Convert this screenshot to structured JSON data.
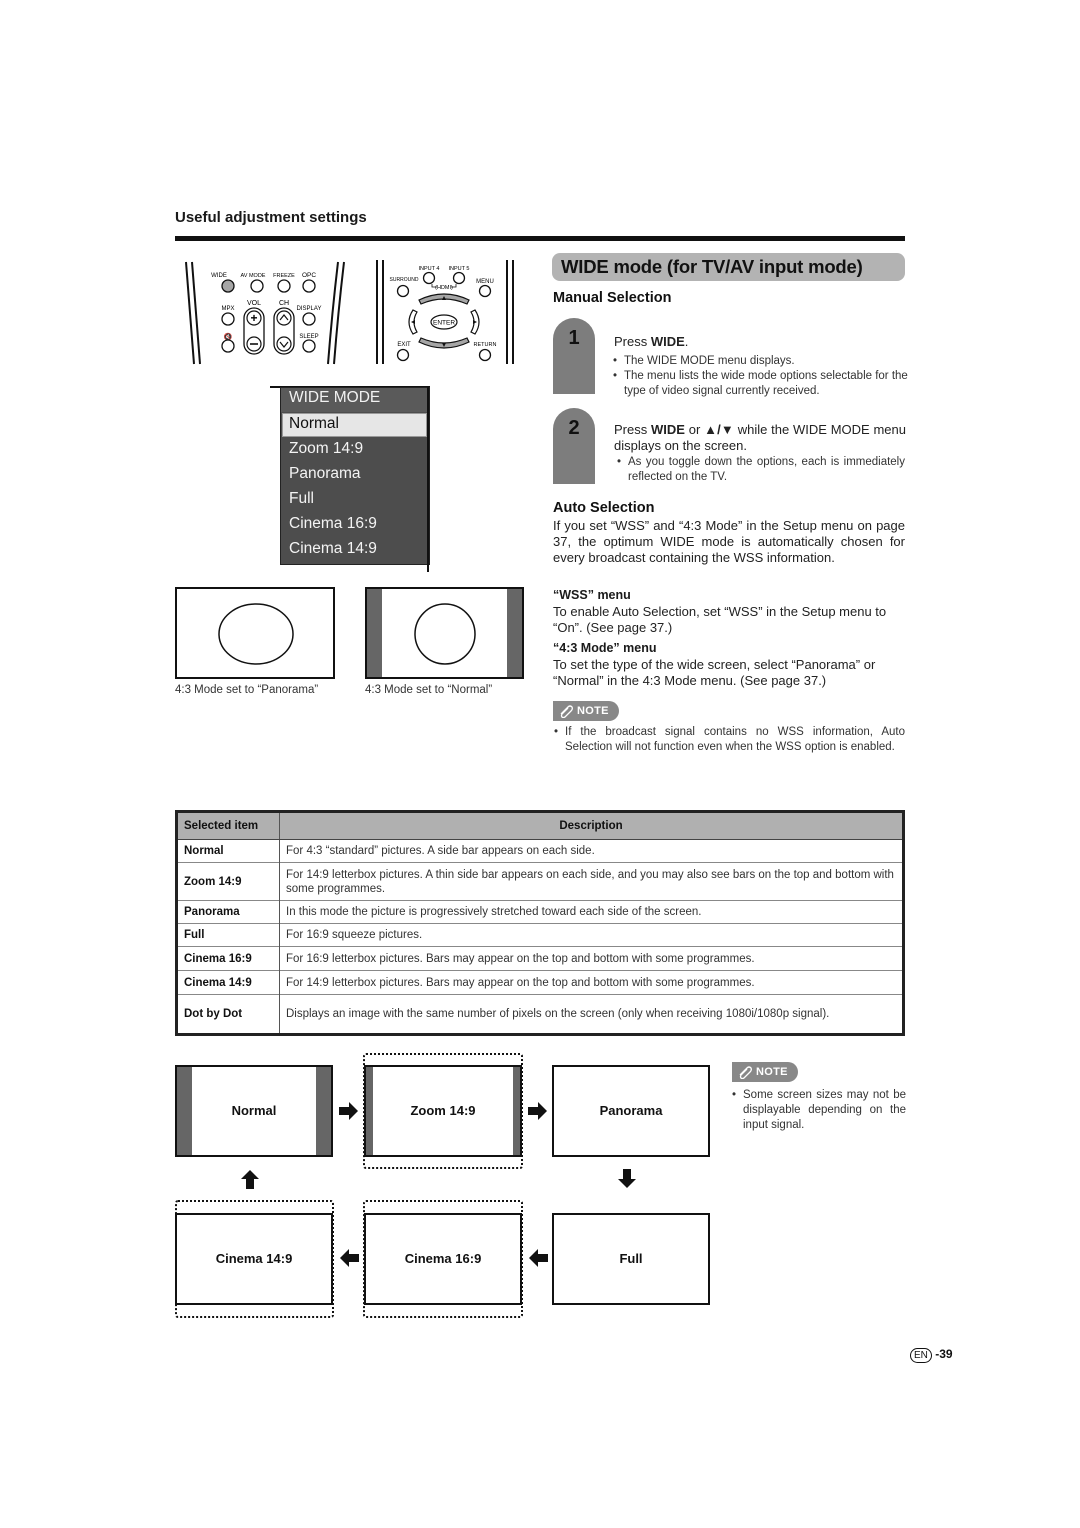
{
  "section": {
    "title": "Useful adjustment settings"
  },
  "remote_left": {
    "labels": {
      "wide": "WIDE",
      "av_mode": "AV MODE",
      "freeze": "FREEZE",
      "opc": "OPC",
      "mpx": "MPX",
      "vol": "VOL",
      "ch": "CH",
      "display": "DISPLAY",
      "sleep": "SLEEP"
    },
    "highlighted_button": "WIDE",
    "highlight_color": "#a6a6a6"
  },
  "remote_right": {
    "labels": {
      "input4": "INPUT 4",
      "input5": "INPUT 5",
      "hdmi": "(HDMI)",
      "surround": "SURROUND",
      "menu": "MENU",
      "enter": "ENTER",
      "exit": "EXIT",
      "return": "RETURN"
    }
  },
  "osd_menu": {
    "title": "WIDE MODE",
    "items": [
      "Normal",
      "Zoom 14:9",
      "Panorama",
      "Full",
      "Cinema 16:9",
      "Cinema 14:9"
    ],
    "selected": "Normal"
  },
  "examples": [
    {
      "caption": "4:3 Mode set to “Panorama”"
    },
    {
      "caption": "4:3 Mode set to “Normal”"
    }
  ],
  "main": {
    "heading": "WIDE mode (for TV/AV input mode)",
    "manual_selection": {
      "title": "Manual Selection",
      "steps": [
        {
          "number": "1",
          "text_prefix": "Press ",
          "text_bold": "WIDE",
          "text_suffix": ".",
          "bullets": [
            "The WIDE MODE menu displays.",
            "The menu lists the wide mode options selectable for the type of video signal currently received."
          ]
        },
        {
          "number": "2",
          "text_prefix": "Press ",
          "text_bold": "WIDE",
          "text_middle": " or ",
          "text_bold2": "▲/▼",
          "text_suffix": " while the WIDE MODE menu displays on the screen.",
          "bullets": [
            "As you toggle down the options, each is immediately reflected on the TV."
          ]
        }
      ]
    },
    "auto_selection": {
      "title": "Auto Selection",
      "text": "If you set “WSS” and “4:3 Mode” in the Setup menu on page 37, the optimum WIDE mode is automatically chosen for every broadcast containing the WSS information.",
      "wss_title": "“WSS” menu",
      "wss_text": "To enable Auto Selection, set “WSS” in the Setup menu to “On”. (See page 37.)",
      "mode43_title": "“4:3 Mode” menu",
      "mode43_text": "To set the type of the wide screen, select “Panorama” or “Normal” in the 4:3 Mode menu. (See page 37.)"
    },
    "note1": {
      "label": "NOTE",
      "bullets": [
        "If the broadcast signal contains no WSS information, Auto Selection will not function even when the WSS option is enabled."
      ]
    }
  },
  "table": {
    "headers": [
      "Selected item",
      "Description"
    ],
    "rows": [
      {
        "item": "Normal",
        "description": "For 4:3 “standard” pictures. A side bar appears on each side."
      },
      {
        "item": "Zoom 14:9",
        "description": "For 14:9 letterbox pictures. A thin side bar appears on each side, and you may also see bars on the top and bottom with some programmes."
      },
      {
        "item": "Panorama",
        "description": "In this mode the picture is progressively stretched toward each side of the screen."
      },
      {
        "item": "Full",
        "description": "For 16:9 squeeze pictures."
      },
      {
        "item": "Cinema 16:9",
        "description": "For 16:9 letterbox pictures. Bars may appear on the top and bottom with some programmes."
      },
      {
        "item": "Cinema 14:9",
        "description": "For 14:9 letterbox pictures. Bars may appear on the top and bottom with some programmes."
      },
      {
        "item": "Dot by Dot",
        "description": "Displays an image with the same number of pixels on the screen (only when receiving 1080i/1080p signal)."
      }
    ]
  },
  "flow": {
    "boxes": [
      "Normal",
      "Zoom 14:9",
      "Panorama",
      "Full",
      "Cinema 16:9",
      "Cinema 14:9"
    ],
    "order_note": "Normal → Zoom 14:9 → Panorama → Full → Cinema 16:9 → Cinema 14:9 → Normal"
  },
  "note2": {
    "label": "NOTE",
    "bullets": [
      "Some screen sizes may not be displayable depending on the input signal."
    ]
  },
  "footer": {
    "lang": "EN",
    "page": "-39"
  },
  "colors": {
    "banner": "#b3b3b3",
    "step_badge": "#7d7d7d",
    "osd_bg": "#4d4d4d",
    "bar": "#666666",
    "table_header": "#b0b0b0"
  }
}
